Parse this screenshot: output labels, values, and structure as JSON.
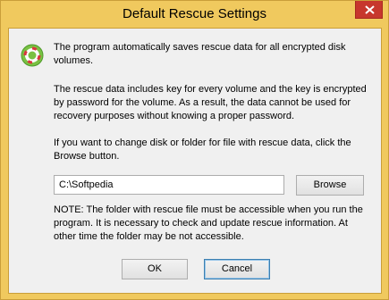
{
  "window": {
    "title": "Default Rescue Settings",
    "close_icon": "close-icon",
    "app_icon": "lifebuoy-icon"
  },
  "content": {
    "paragraph1": "The program automatically saves rescue data for all encrypted disk volumes.",
    "paragraph2": "The rescue data includes key for every volume and the key is encrypted by password for the volume. As a result, the data cannot be used for recovery purposes without knowing a proper password.",
    "paragraph3": "If you want to change disk or folder for file with rescue data, click the Browse button.",
    "path_value": "C:\\Softpedia",
    "browse_label": "Browse",
    "note": "NOTE: The folder with rescue file must be accessible when you run the program. It is necessary to check and update rescue information. At other time the folder may be not accessible."
  },
  "buttons": {
    "ok_label": "OK",
    "cancel_label": "Cancel"
  },
  "colors": {
    "titlebar": "#f0c95e",
    "close_button": "#c7372d",
    "client_bg": "#f0f0f0",
    "default_button_border": "#3c7fb1"
  }
}
